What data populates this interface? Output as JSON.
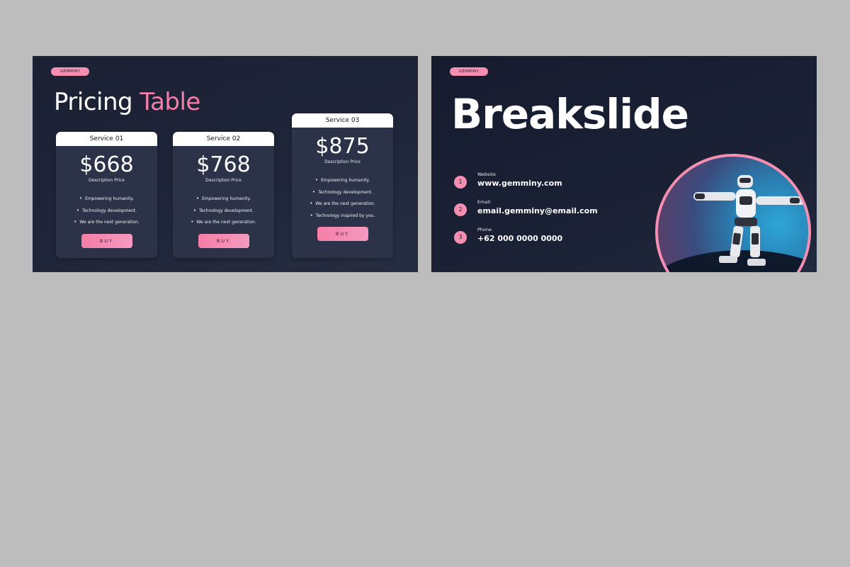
{
  "slide1": {
    "brand": "GEMMINY",
    "title_main": "Pricing",
    "title_accent": "Table",
    "cards": [
      {
        "service": "Service 01",
        "price": "$668",
        "desc": "Description Price",
        "features": [
          "Empowering humanity.",
          "Technology development.",
          "We are the next generation."
        ],
        "buy": "BUY"
      },
      {
        "service": "Service 02",
        "price": "$768",
        "desc": "Description Price",
        "features": [
          "Empowering humanity.",
          "Technology development.",
          "We are the next generation."
        ],
        "buy": "BUY"
      },
      {
        "service": "Service 03",
        "price": "$875",
        "desc": "Description Price",
        "features": [
          "Empowering humanity.",
          "Technology development.",
          "We are the next generation.",
          "Technology inspired by you."
        ],
        "buy": "BUY"
      }
    ]
  },
  "slide2": {
    "brand": "GEMMINY",
    "title": "Breakslide",
    "contacts": [
      {
        "num": "1",
        "label": "Website",
        "value": "www.gemminy.com"
      },
      {
        "num": "2",
        "label": "Email",
        "value": "email.gemminy@email.com"
      },
      {
        "num": "3",
        "label": "Phone",
        "value": "+62 000 0000 0000"
      }
    ]
  },
  "colors": {
    "accent": "#f48fb1",
    "slide_bg": "#1b2033",
    "card_bg": "#2c3348",
    "canvas_bg": "#bdbdbd"
  },
  "icons": {
    "robot": "robot-icon"
  }
}
